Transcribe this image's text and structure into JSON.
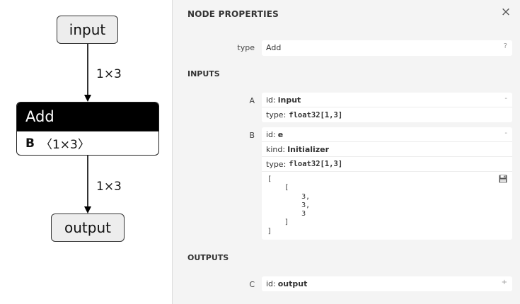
{
  "graph": {
    "nodes": {
      "input": "input",
      "add_op": "Add",
      "add_attr_name": "B",
      "add_attr_value": "〈1×3〉",
      "output": "output"
    },
    "edges": [
      "1×3",
      "1×3"
    ]
  },
  "sidebar": {
    "title": "NODE PROPERTIES",
    "close_icon": "×",
    "type_label": "type",
    "type_value": "Add",
    "type_help": "?",
    "inputs_section": "INPUTS",
    "inputs": [
      {
        "name": "A",
        "id_key": "id:",
        "id_value": "input",
        "toggle": "-",
        "type_key": "type:",
        "type_value": "float32[1,3]"
      },
      {
        "name": "B",
        "id_key": "id:",
        "id_value": "e",
        "toggle": "-",
        "kind_key": "kind:",
        "kind_value": "Initializer",
        "type_key": "type:",
        "type_value": "float32[1,3]",
        "tensor_text": "[\n    [\n        3,\n        3,\n        3\n    ]\n]",
        "save_icon": "floppy-disk"
      }
    ],
    "outputs_section": "OUTPUTS",
    "outputs": [
      {
        "name": "C",
        "id_key": "id:",
        "id_value": "output",
        "toggle": "+"
      }
    ]
  }
}
